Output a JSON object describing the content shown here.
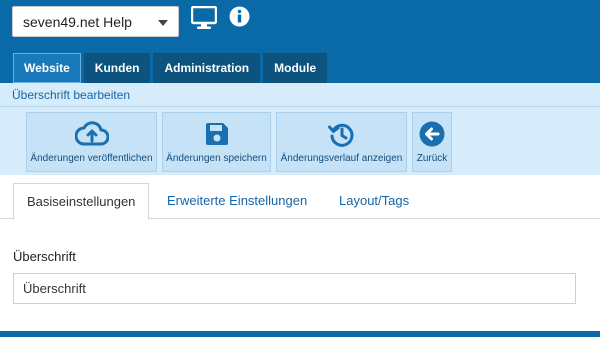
{
  "header": {
    "site_select": "seven49.net Help",
    "icons": [
      "monitor-icon",
      "info-icon"
    ]
  },
  "nav": {
    "tabs": [
      {
        "label": "Website",
        "active": true
      },
      {
        "label": "Kunden",
        "active": false
      },
      {
        "label": "Administration",
        "active": false
      },
      {
        "label": "Module",
        "active": false
      }
    ]
  },
  "breadcrumb": "Überschrift bearbeiten",
  "toolbar": {
    "buttons": [
      {
        "label": "Änderungen veröffentlichen",
        "icon": "cloud-upload-icon"
      },
      {
        "label": "Änderungen speichern",
        "icon": "save-icon"
      },
      {
        "label": "Änderungsverlauf anzeigen",
        "icon": "history-icon"
      },
      {
        "label": "Zurück",
        "icon": "arrow-left-circle-icon"
      }
    ]
  },
  "page_tabs": [
    {
      "label": "Basiseinstellungen",
      "active": true
    },
    {
      "label": "Erweiterte Einstellungen",
      "active": false
    },
    {
      "label": "Layout/Tags",
      "active": false
    }
  ],
  "form": {
    "label": "Überschrift",
    "value": "Überschrift"
  },
  "colors": {
    "header_bg": "#0a6aa8",
    "toolbar_bg": "#d6ecfa",
    "button_bg": "#c6e2f6",
    "icon_blue": "#1a6fb0"
  }
}
